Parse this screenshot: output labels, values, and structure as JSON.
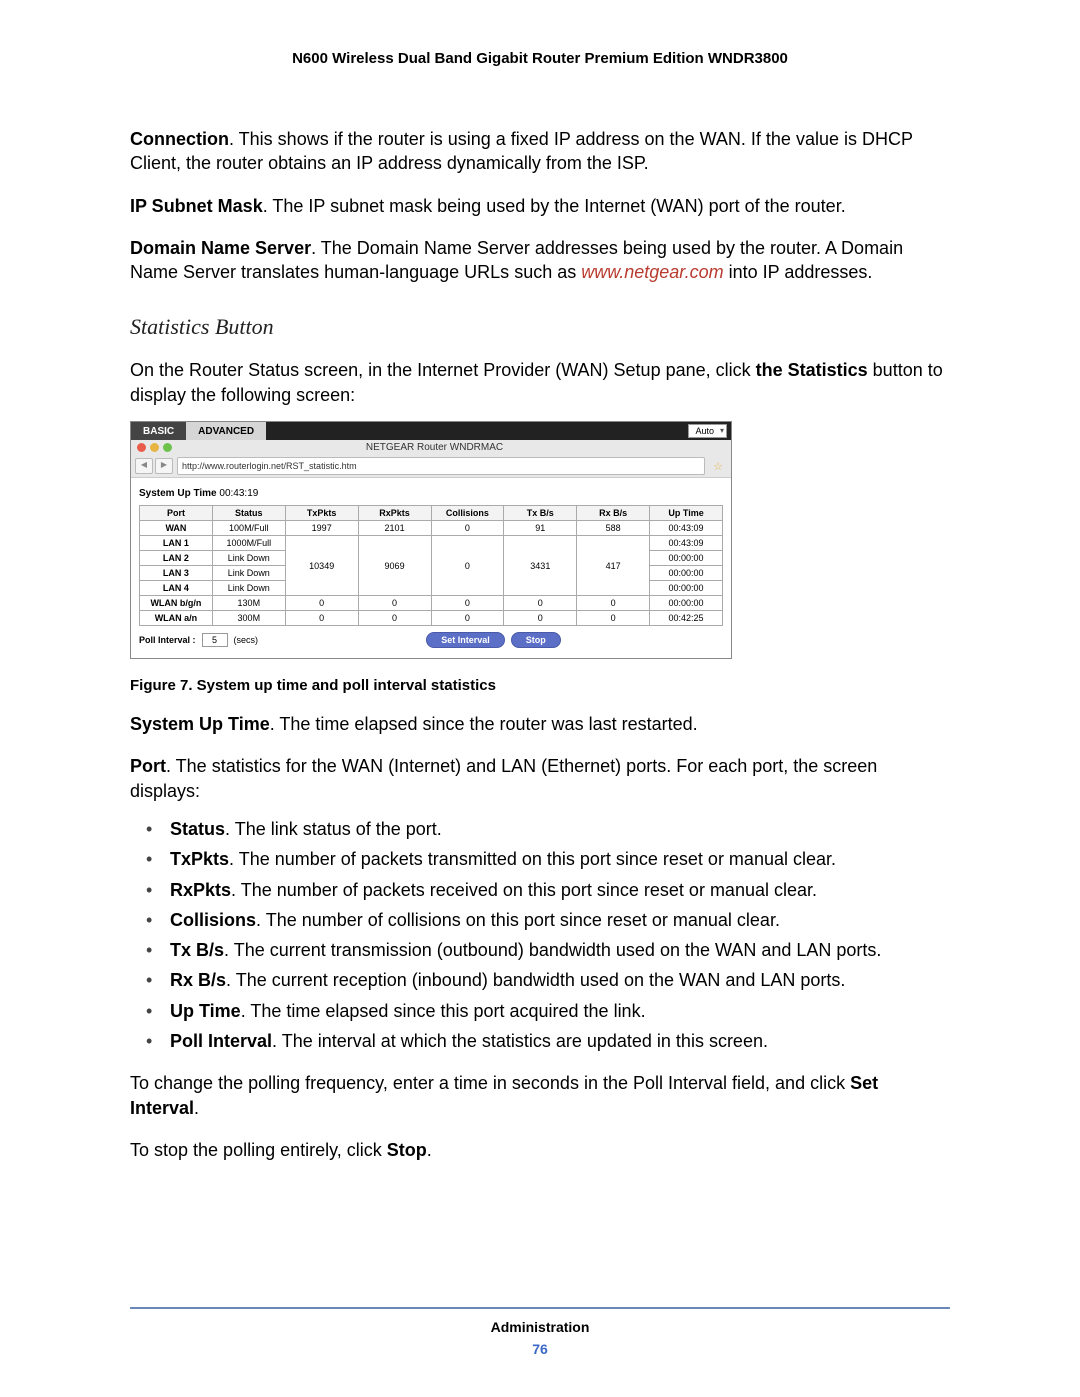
{
  "header": {
    "title": "N600 Wireless Dual Band Gigabit Router Premium Edition WNDR3800"
  },
  "paragraphs": {
    "connection_label": "Connection",
    "connection_text": ". This shows if the router is using a fixed IP address on the WAN. If the value is DHCP Client, the router obtains an IP address dynamically from the ISP.",
    "ip_mask_label": "IP Subnet Mask",
    "ip_mask_text": ". The IP subnet mask being used by the Internet (WAN) port of the router.",
    "dns_label": "Domain Name Server",
    "dns_text_a": ". The Domain Name Server addresses being used by the router. A Domain Name Server translates human-language URLs such as ",
    "dns_link": "www.netgear.com",
    "dns_text_b": " into IP addresses.",
    "section_heading": "Statistics Button",
    "stats_intro_a": "On the Router Status screen, in the Internet Provider (WAN) Setup pane, click ",
    "stats_intro_bold": "the Statistics",
    "stats_intro_b": " button to display the following screen:",
    "caption": "Figure 7. System up time and poll interval statistics",
    "system_up_label": "System Up Time",
    "system_up_text": ". The time elapsed since the router was last restarted.",
    "port_label": "Port",
    "port_text": ". The statistics for the WAN (Internet) and LAN (Ethernet) ports. For each port, the screen displays:",
    "change_poll_a": "To change the polling frequency, enter a time in seconds in the Poll Interval field, and click ",
    "change_poll_bold": "Set Interval",
    "stop_poll_a": "To stop the polling entirely, click ",
    "stop_poll_bold": "Stop"
  },
  "definitions": {
    "status": {
      "label": "Status",
      "text": ". The link status of the port."
    },
    "txpkts": {
      "label": "TxPkts",
      "text": ". The number of packets transmitted on this port since reset or manual clear."
    },
    "rxpkts": {
      "label": "RxPkts",
      "text": ". The number of packets received on this port since reset or manual clear."
    },
    "collisions": {
      "label": "Collisions",
      "text": ". The number of collisions on this port since reset or manual clear."
    },
    "txbs": {
      "label": "Tx B/s",
      "text": ". The current transmission (outbound) bandwidth used on the WAN and LAN ports."
    },
    "rxbs": {
      "label": "Rx B/s",
      "text": ". The current reception (inbound) bandwidth used on the WAN and LAN ports."
    },
    "uptime": {
      "label": "Up Time",
      "text": ". The time elapsed since this port acquired the link."
    },
    "pollint": {
      "label": "Poll Interval",
      "text": ". The interval at which the statistics are updated in this screen."
    }
  },
  "screenshot": {
    "tabs": {
      "basic": "BASIC",
      "advanced": "ADVANCED"
    },
    "auto": "Auto",
    "window_title": "NETGEAR Router WNDRMAC",
    "url": "http://www.routerlogin.net/RST_statistic.htm",
    "uptime_label": "System Up Time",
    "uptime_value": "00:43:19",
    "headers": [
      "Port",
      "Status",
      "TxPkts",
      "RxPkts",
      "Collisions",
      "Tx B/s",
      "Rx B/s",
      "Up Time"
    ],
    "rows": {
      "wan": {
        "port": "WAN",
        "status": "100M/Full",
        "tx": "1997",
        "rx": "2101",
        "col": "0",
        "txb": "91",
        "rxb": "588",
        "up": "00:43:09"
      },
      "lan1": {
        "port": "LAN 1",
        "status": "1000M/Full",
        "tx": "",
        "rx": "",
        "col": "",
        "txb": "",
        "rxb": "",
        "up": "00:43:09"
      },
      "lan2": {
        "port": "LAN 2",
        "status": "Link Down",
        "tx": "10349",
        "rx": "9069",
        "col": "0",
        "txb": "3431",
        "rxb": "417",
        "up": "00:00:00"
      },
      "lan3": {
        "port": "LAN 3",
        "status": "Link Down",
        "tx": "",
        "rx": "",
        "col": "",
        "txb": "",
        "rxb": "",
        "up": "00:00:00"
      },
      "lan4": {
        "port": "LAN 4",
        "status": "Link Down",
        "tx": "",
        "rx": "",
        "col": "",
        "txb": "",
        "rxb": "",
        "up": "00:00:00"
      },
      "wlanbgn": {
        "port": "WLAN b/g/n",
        "status": "130M",
        "tx": "0",
        "rx": "0",
        "col": "0",
        "txb": "0",
        "rxb": "0",
        "up": "00:00:00"
      },
      "wlanan": {
        "port": "WLAN a/n",
        "status": "300M",
        "tx": "0",
        "rx": "0",
        "col": "0",
        "txb": "0",
        "rxb": "0",
        "up": "00:42:25"
      }
    },
    "poll_label": "Poll Interval :",
    "poll_value": "5",
    "poll_unit": "(secs)",
    "set_interval_btn": "Set Interval",
    "stop_btn": "Stop"
  },
  "footer": {
    "section": "Administration",
    "page": "76"
  }
}
